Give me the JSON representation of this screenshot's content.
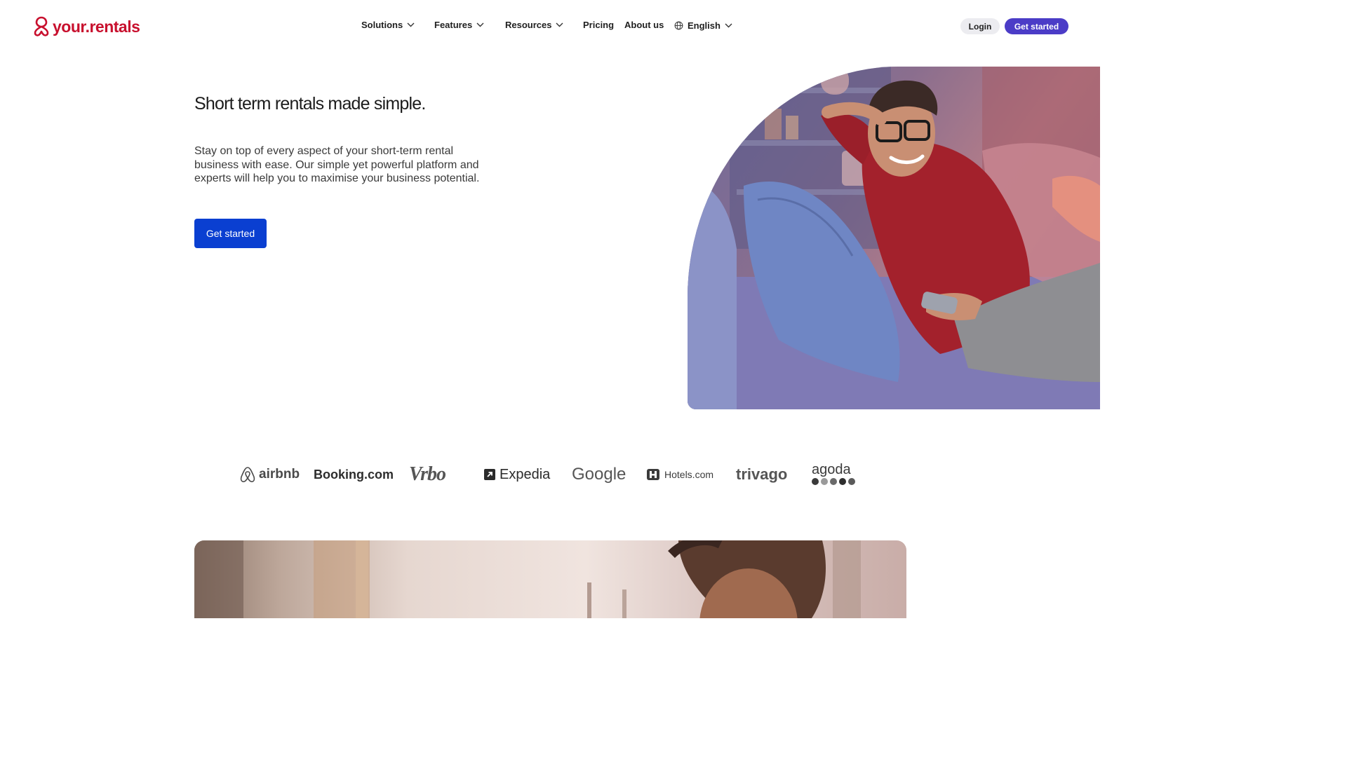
{
  "header": {
    "logo_text": "your.rentals",
    "nav": [
      {
        "label": "Solutions",
        "has_dropdown": true
      },
      {
        "label": "Features",
        "has_dropdown": true
      },
      {
        "label": "Resources",
        "has_dropdown": true
      },
      {
        "label": "Pricing",
        "has_dropdown": false
      },
      {
        "label": "About us",
        "has_dropdown": false
      }
    ],
    "language": "English",
    "login_label": "Login",
    "cta_label": "Get started"
  },
  "hero": {
    "title": "Short term rentals made simple.",
    "text": "Stay on top of every aspect of your short-term rental business with ease. Our simple yet powerful platform and experts will help you to maximise your business potential.",
    "cta_label": "Get started"
  },
  "partners": {
    "airbnb": "airbnb",
    "booking": "Booking.com",
    "vrbo": "Vrbo",
    "expedia": "Expedia",
    "google": "Google",
    "hotels": "Hotels.com",
    "trivago": "trivago",
    "agoda": "agoda"
  },
  "colors": {
    "brand": "#c8102e",
    "header_cta": "#4b3cc7",
    "hero_cta": "#0a3fd1",
    "login_bg": "#ececf0"
  },
  "icons": [
    "your-rentals-logo-icon",
    "chevron-down-icon",
    "globe-icon",
    "airbnb-icon",
    "expedia-icon",
    "hotels-icon"
  ]
}
